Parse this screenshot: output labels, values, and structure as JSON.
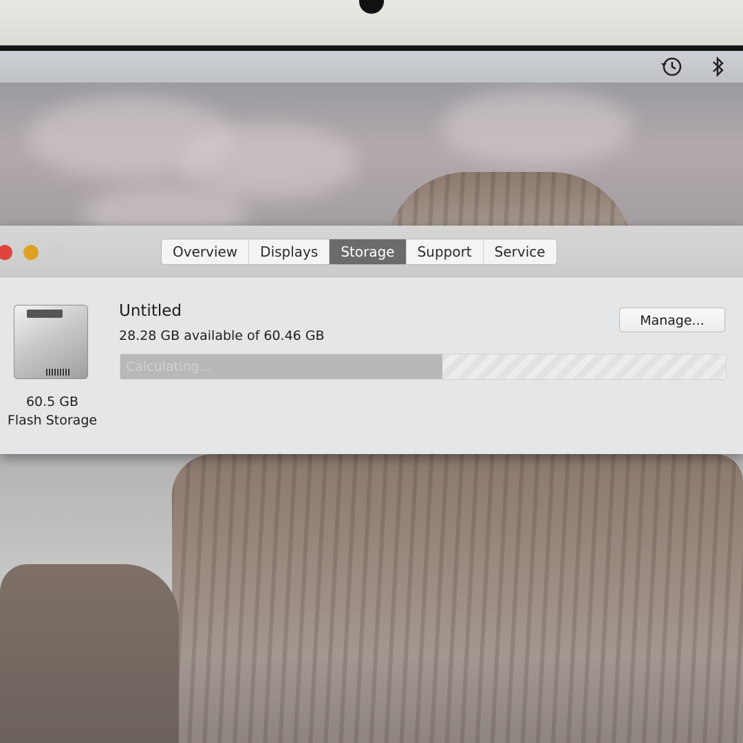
{
  "tabs": [
    {
      "label": "Overview"
    },
    {
      "label": "Displays"
    },
    {
      "label": "Storage"
    },
    {
      "label": "Support"
    },
    {
      "label": "Service"
    }
  ],
  "active_tab": "Storage",
  "disk": {
    "size": "60.5 GB",
    "type": "Flash Storage"
  },
  "volume": {
    "name": "Untitled",
    "availability": "28.28 GB available of 60.46 GB",
    "used_fraction": 0.532,
    "status": "Calculating..."
  },
  "manage_label": "Manage...",
  "colors": {
    "close": "#e0443e",
    "minimize": "#dea123",
    "zoom_disabled": "#cfcfcf",
    "active_tab": "#6b6b6b"
  }
}
